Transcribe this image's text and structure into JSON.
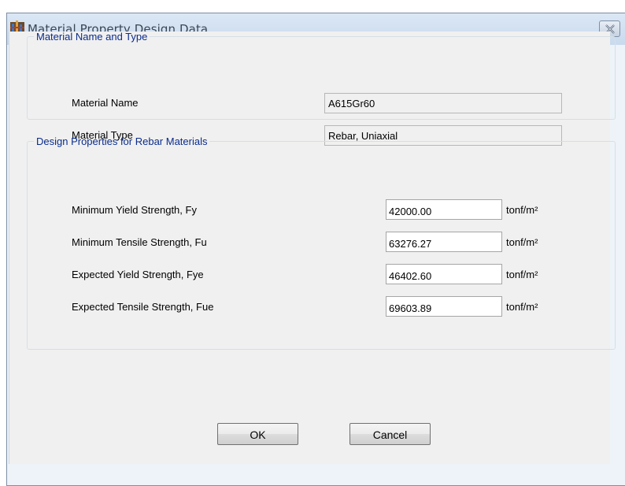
{
  "window": {
    "title": "Material Property Design Data",
    "close_glyph": "close-icon"
  },
  "name_type_group": {
    "legend": "Material Name and Type",
    "material_name_label": "Material Name",
    "material_name_value": "A615Gr60",
    "material_type_label": "Material Type",
    "material_type_value": "Rebar, Uniaxial"
  },
  "design_group": {
    "legend": "Design Properties for Rebar Materials",
    "rows": [
      {
        "label": "Minimum Yield Strength, Fy",
        "value": "42000.00",
        "unit": "tonf/m²"
      },
      {
        "label": "Minimum Tensile Strength, Fu",
        "value": "63276.27",
        "unit": "tonf/m²"
      },
      {
        "label": "Expected Yield Strength, Fye",
        "value": "46402.60",
        "unit": "tonf/m²"
      },
      {
        "label": "Expected Tensile Strength, Fue",
        "value": "69603.89",
        "unit": "tonf/m²"
      }
    ]
  },
  "buttons": {
    "ok": "OK",
    "cancel": "Cancel"
  },
  "colors": {
    "legend_text": "#0a2c8c",
    "dialog_background": "#f0f0f0",
    "titlebar": "#dbe7f5"
  }
}
